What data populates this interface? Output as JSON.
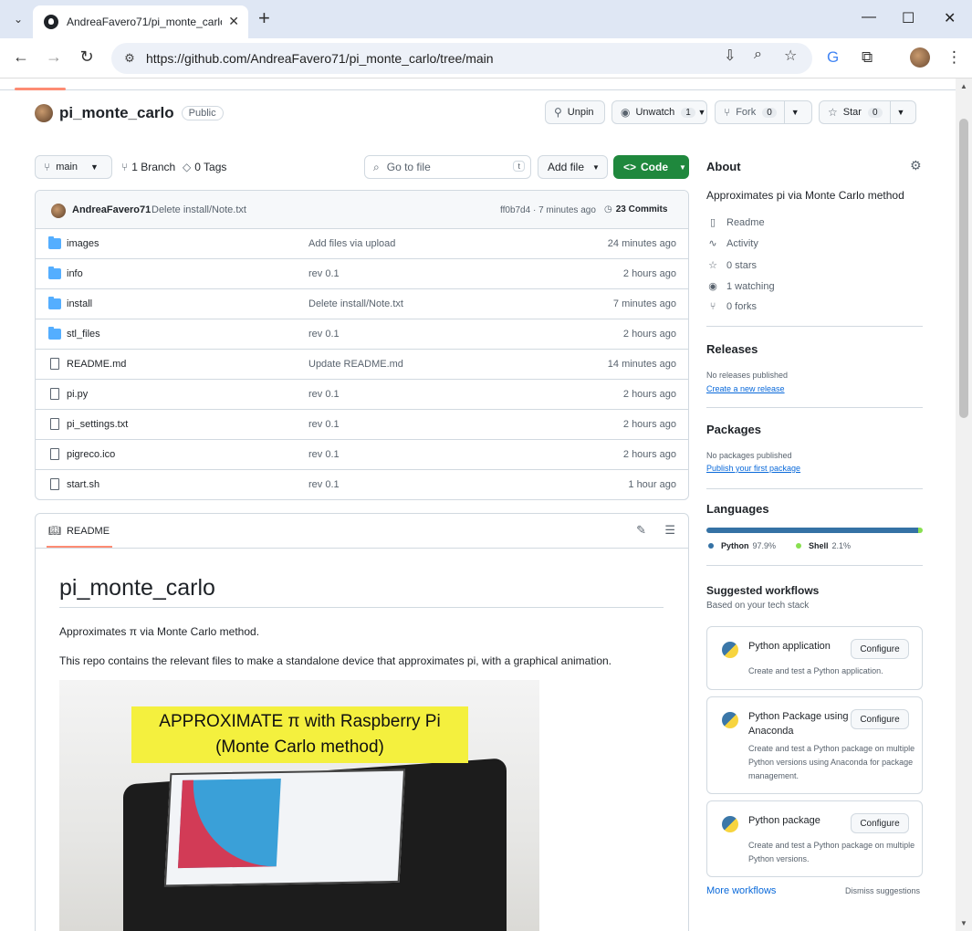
{
  "browser": {
    "tab_title": "AndreaFavero71/pi_monte_carlo",
    "url": "https://github.com/AndreaFavero71/pi_monte_carlo/tree/main"
  },
  "repo": {
    "name": "pi_monte_carlo",
    "visibility": "Public",
    "unpin": "Unpin",
    "unwatch": "Unwatch",
    "watch_count": "1",
    "fork": "Fork",
    "fork_count": "0",
    "star": "Star",
    "star_count": "0"
  },
  "branch_bar": {
    "branch": "main",
    "branches": "1 Branch",
    "tags": "0 Tags",
    "search_placeholder": "Go to file",
    "search_key": "t",
    "add_file": "Add file",
    "code": "Code"
  },
  "latest_commit": {
    "author": "AndreaFavero71",
    "message": "Delete install/Note.txt",
    "sha_time": "ff0b7d4 · 7 minutes ago",
    "commits": "23 Commits"
  },
  "files": [
    {
      "name": "images",
      "type": "folder",
      "message": "Add files via upload",
      "date": "24 minutes ago"
    },
    {
      "name": "info",
      "type": "folder",
      "message": "rev 0.1",
      "date": "2 hours ago"
    },
    {
      "name": "install",
      "type": "folder",
      "message": "Delete install/Note.txt",
      "date": "7 minutes ago"
    },
    {
      "name": "stl_files",
      "type": "folder",
      "message": "rev 0.1",
      "date": "2 hours ago"
    },
    {
      "name": "README.md",
      "type": "file",
      "message": "Update README.md",
      "date": "14 minutes ago"
    },
    {
      "name": "pi.py",
      "type": "file",
      "message": "rev 0.1",
      "date": "2 hours ago"
    },
    {
      "name": "pi_settings.txt",
      "type": "file",
      "message": "rev 0.1",
      "date": "2 hours ago"
    },
    {
      "name": "pigreco.ico",
      "type": "file",
      "message": "rev 0.1",
      "date": "2 hours ago"
    },
    {
      "name": "start.sh",
      "type": "file",
      "message": "rev 0.1",
      "date": "1 hour ago"
    }
  ],
  "readme": {
    "tab": "README",
    "title": "pi_monte_carlo",
    "p1": "Approximates π via Monte Carlo method.",
    "p2": "This repo contains the relevant files to make a standalone device that approximates pi, with a graphical animation.",
    "banner_line1": "APPROXIMATE π with Raspberry Pi",
    "banner_line2": "(Monte Carlo method)"
  },
  "about": {
    "title": "About",
    "description": "Approximates pi via Monte Carlo method",
    "readme": "Readme",
    "activity": "Activity",
    "stars": "0 stars",
    "watching": "1 watching",
    "forks": "0 forks"
  },
  "releases": {
    "title": "Releases",
    "none": "No releases published",
    "link": "Create a new release"
  },
  "packages": {
    "title": "Packages",
    "none": "No packages published",
    "link": "Publish your first package"
  },
  "languages": {
    "title": "Languages",
    "items": [
      {
        "name": "Python",
        "pct": "97.9%",
        "color": "#3572A5"
      },
      {
        "name": "Shell",
        "pct": "2.1%",
        "color": "#89e051"
      }
    ]
  },
  "workflows": {
    "title": "Suggested workflows",
    "subtitle": "Based on your tech stack",
    "configure": "Configure",
    "items": [
      {
        "title": "Python application",
        "desc": "Create and test a Python application."
      },
      {
        "title": "Python Package using Anaconda",
        "desc": "Create and test a Python package on multiple Python versions using Anaconda for package management."
      },
      {
        "title": "Python package",
        "desc": "Create and test a Python package on multiple Python versions."
      }
    ],
    "more": "More workflows",
    "dismiss": "Dismiss suggestions"
  },
  "colors": {
    "accent": "#1f883d",
    "link": "#0969da",
    "folder": "#54aeff",
    "underline": "#fd8c73"
  }
}
